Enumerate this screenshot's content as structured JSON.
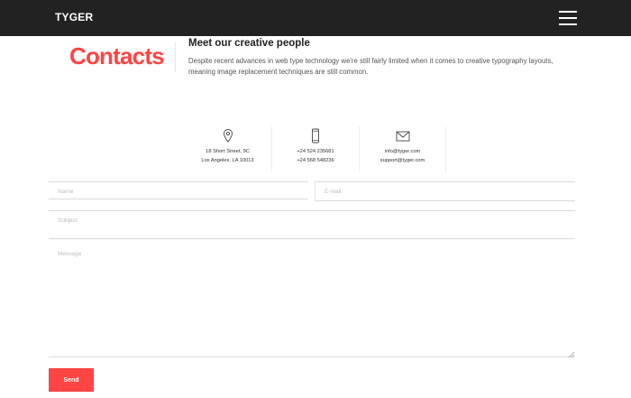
{
  "header": {
    "logo": "TYGER",
    "menu_icon": "hamburger-menu-icon",
    "background": "#222222"
  },
  "hero": {
    "title": "Contacts",
    "heading": "Meet our creative people",
    "text": "Despite recent advances in web type technology we're still fairly limited when it comes to creative typography layouts, meaning image replacement techniques are still common.",
    "accent": "#ff4444"
  },
  "contact_info": [
    {
      "icon": "map-pin-icon",
      "lines": [
        "18 Short Street, 9C",
        "Los Angeles, LA 10013"
      ]
    },
    {
      "icon": "smartphone-icon",
      "lines": [
        "+24 524 235681",
        "+24 568 548236"
      ]
    },
    {
      "icon": "envelope-icon",
      "lines": [
        "info@tyger.com",
        "support@tyger.com"
      ]
    }
  ],
  "form": {
    "name_placeholder": "Name",
    "email_placeholder": "E-mail",
    "subject_placeholder": "Subject",
    "message_placeholder": "Message",
    "send_label": "Send"
  }
}
